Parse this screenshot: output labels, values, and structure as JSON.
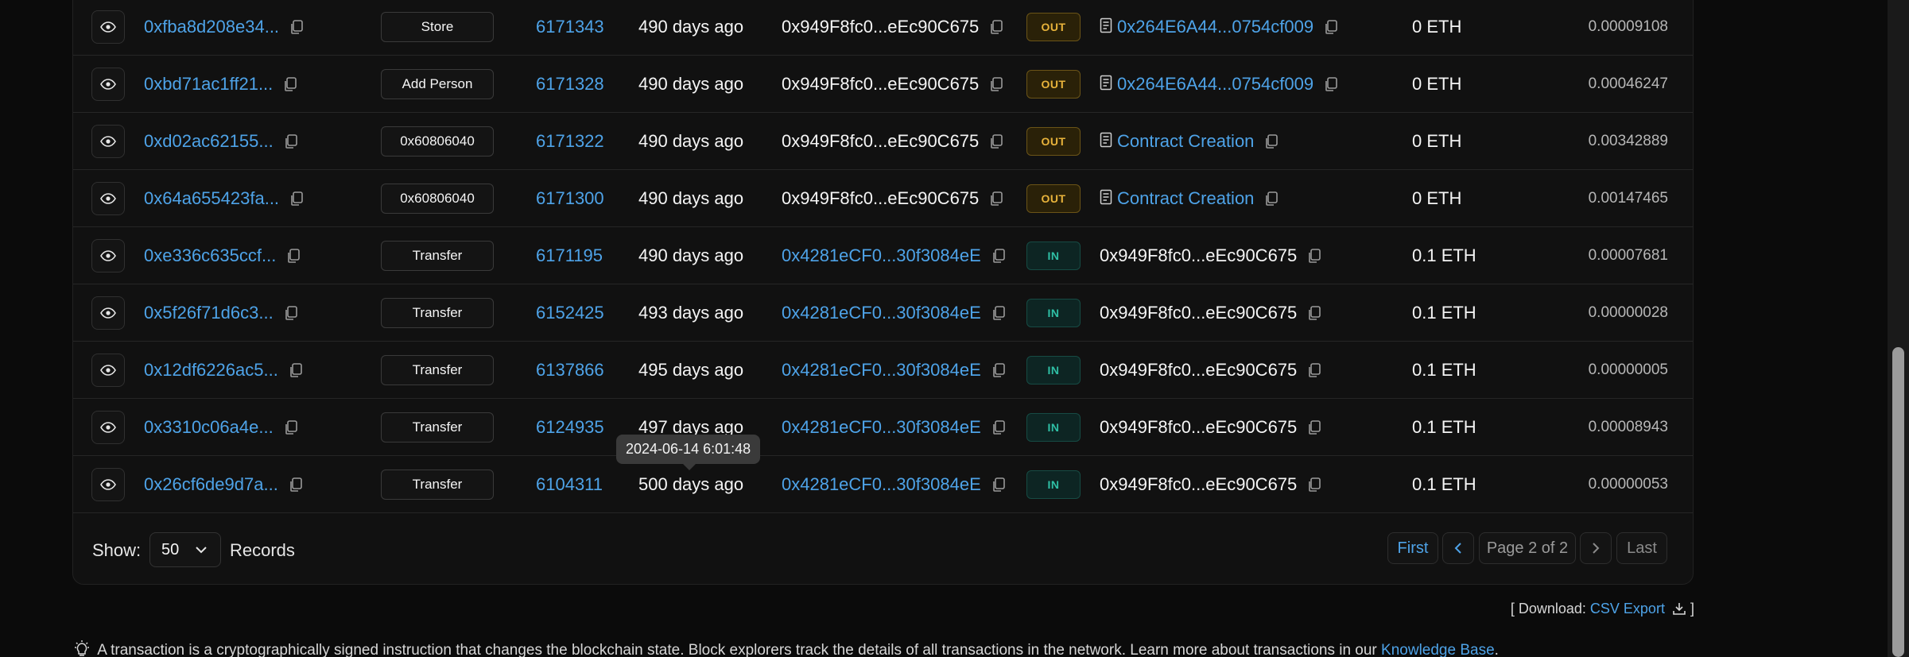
{
  "rows": [
    {
      "hash": "0xfba8d208e34...",
      "method": "Store",
      "block": "6171343",
      "age": "490 days ago",
      "from": "0x949F8fc0...eEc90C675",
      "from_is_link": false,
      "direction": "OUT",
      "to": "0x264E6A44...0754cf009",
      "to_is_contract": true,
      "amount": "0 ETH",
      "fee": "0.00009108"
    },
    {
      "hash": "0xbd71ac1ff21...",
      "method": "Add Person",
      "block": "6171328",
      "age": "490 days ago",
      "from": "0x949F8fc0...eEc90C675",
      "from_is_link": false,
      "direction": "OUT",
      "to": "0x264E6A44...0754cf009",
      "to_is_contract": true,
      "amount": "0 ETH",
      "fee": "0.00046247"
    },
    {
      "hash": "0xd02ac62155...",
      "method": "0x60806040",
      "block": "6171322",
      "age": "490 days ago",
      "from": "0x949F8fc0...eEc90C675",
      "from_is_link": false,
      "direction": "OUT",
      "to": "Contract Creation",
      "to_is_contract": true,
      "amount": "0 ETH",
      "fee": "0.00342889"
    },
    {
      "hash": "0x64a655423fa...",
      "method": "0x60806040",
      "block": "6171300",
      "age": "490 days ago",
      "from": "0x949F8fc0...eEc90C675",
      "from_is_link": false,
      "direction": "OUT",
      "to": "Contract Creation",
      "to_is_contract": true,
      "amount": "0 ETH",
      "fee": "0.00147465"
    },
    {
      "hash": "0xe336c635ccf...",
      "method": "Transfer",
      "block": "6171195",
      "age": "490 days ago",
      "from": "0x4281eCF0...30f3084eE",
      "from_is_link": true,
      "direction": "IN",
      "to": "0x949F8fc0...eEc90C675",
      "to_is_contract": false,
      "amount": "0.1 ETH",
      "fee": "0.00007681"
    },
    {
      "hash": "0x5f26f71d6c3...",
      "method": "Transfer",
      "block": "6152425",
      "age": "493 days ago",
      "from": "0x4281eCF0...30f3084eE",
      "from_is_link": true,
      "direction": "IN",
      "to": "0x949F8fc0...eEc90C675",
      "to_is_contract": false,
      "amount": "0.1 ETH",
      "fee": "0.00000028"
    },
    {
      "hash": "0x12df6226ac5...",
      "method": "Transfer",
      "block": "6137866",
      "age": "495 days ago",
      "from": "0x4281eCF0...30f3084eE",
      "from_is_link": true,
      "direction": "IN",
      "to": "0x949F8fc0...eEc90C675",
      "to_is_contract": false,
      "amount": "0.1 ETH",
      "fee": "0.00000005"
    },
    {
      "hash": "0x3310c06a4e...",
      "method": "Transfer",
      "block": "6124935",
      "age": "497 days ago",
      "from": "0x4281eCF0...30f3084eE",
      "from_is_link": true,
      "direction": "IN",
      "to": "0x949F8fc0...eEc90C675",
      "to_is_contract": false,
      "amount": "0.1 ETH",
      "fee": "0.00008943"
    },
    {
      "hash": "0x26cf6de9d7a...",
      "method": "Transfer",
      "block": "6104311",
      "age": "500 days ago",
      "from": "0x4281eCF0...30f3084eE",
      "from_is_link": true,
      "direction": "IN",
      "to": "0x949F8fc0...eEc90C675",
      "to_is_contract": false,
      "amount": "0.1 ETH",
      "fee": "0.00000053"
    }
  ],
  "tooltip": {
    "text": "2024-06-14 6:01:48"
  },
  "pagination": {
    "show_label": "Show:",
    "page_size": "50",
    "records_label": "Records",
    "first": "First",
    "page_info": "Page 2 of 2",
    "last": "Last"
  },
  "download": {
    "prefix": "[ Download:",
    "csv_label": "CSV Export",
    "suffix": "]"
  },
  "note": {
    "text": "A transaction is a cryptographically signed instruction that changes the blockchain state. Block explorers track the details of all transactions in the network. Learn more about transactions in our",
    "link": "Knowledge Base",
    "end": "."
  },
  "colors": {
    "accent": "#4ea3e8",
    "out": "#e8b33b",
    "in": "#2fbfa5",
    "background": "#0b0b0b"
  }
}
